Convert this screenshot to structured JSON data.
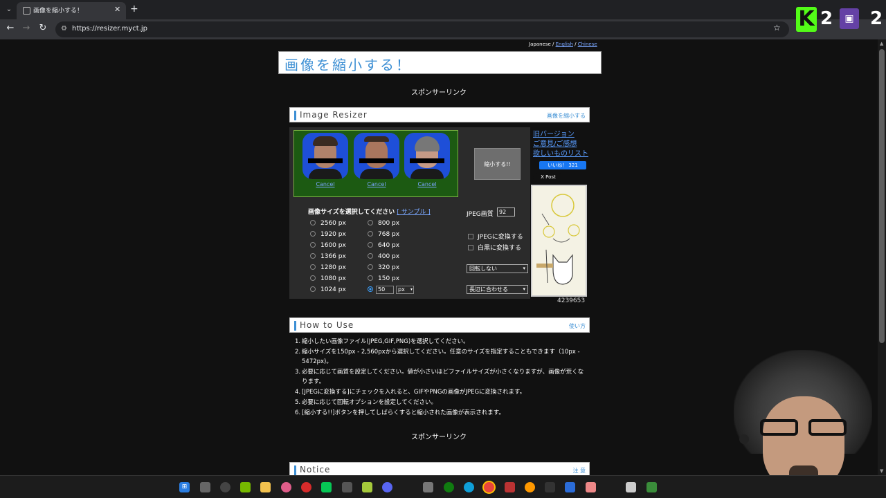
{
  "browser": {
    "tab_title": "画像を縮小する！",
    "url": "https://resizer.myct.jp",
    "tab_close": "✕",
    "new_tab": "+",
    "back": "←",
    "forward": "→",
    "reload": "↻",
    "bookmark": "☆"
  },
  "overlay": {
    "kick_count": "2",
    "twitch_count": "2",
    "kick_letter": "K"
  },
  "page": {
    "lang_japanese": "Japanese",
    "lang_sep": " / ",
    "lang_english": "English",
    "lang_chinese": "Chinese",
    "logo_text": "画像を縮小する！",
    "sponsor_top": "スポンサーリンク",
    "sponsor_bottom": "スポンサーリンク",
    "resizer_title": "Image Resizer",
    "resizer_link": "画像を縮小する",
    "cancel_labels": [
      "Cancel",
      "Cancel",
      "Cancel"
    ],
    "shrink_button": "縮小する!!",
    "size_title": "画像サイズを選択してください",
    "sample_link": "[ サンプル ]",
    "sizes_left": [
      "2560 px",
      "1920 px",
      "1600 px",
      "1366 px",
      "1280 px",
      "1080 px",
      "1024 px"
    ],
    "sizes_right": [
      "800 px",
      "768 px",
      "640 px",
      "400 px",
      "320 px",
      "150 px"
    ],
    "custom_value": "50",
    "custom_unit": "px",
    "jpeg_quality_label": "JPEG画質",
    "jpeg_quality_value": "92",
    "convert_jpeg": "JPEGに変換する",
    "convert_bw": "白黒に変換する",
    "rotate_option": "回転しない",
    "fit_option": "長辺に合わせる",
    "side_links": [
      "旧バージョン",
      "ご意見/ご感想",
      "欲しいものリスト"
    ],
    "fb_like": "いいね！ 321",
    "x_post": "X Post",
    "visitor_count": "4239653",
    "howto_title": "How to Use",
    "howto_link": "使い方",
    "howto_steps": [
      {
        "num": "1.",
        "text": "縮小したい画像ファイル(JPEG,GIF,PNG)を選択してください。"
      },
      {
        "num": "2.",
        "text": "縮小サイズを150px - 2,560pxから選択してください。任意のサイズを指定することもできます（10px - 5472px)。"
      },
      {
        "num": "3.",
        "text": "必要に応じて画質を設定してください。値が小さいほどファイルサイズが小さくなりますが、画像が荒くなります。"
      },
      {
        "num": "4.",
        "text": "[JPEGに変換する]にチェックを入れると、GIFやPNGの画像がJPEGに変換されます。"
      },
      {
        "num": "5.",
        "text": "必要に応じて回転オプションを設定してください。"
      },
      {
        "num": "6.",
        "text": "[縮小する!!]ボタンを押してしばらくすると縮小された画像が表示されます。"
      }
    ],
    "notice_title": "Notice",
    "notice_link": "注 意"
  },
  "colors": {
    "accent": "#3c8fd4",
    "page_bg": "#111111",
    "panel_bg": "#2b2b2b",
    "thumbs_bg": "#1c5a12",
    "link": "#7aa7ff"
  }
}
